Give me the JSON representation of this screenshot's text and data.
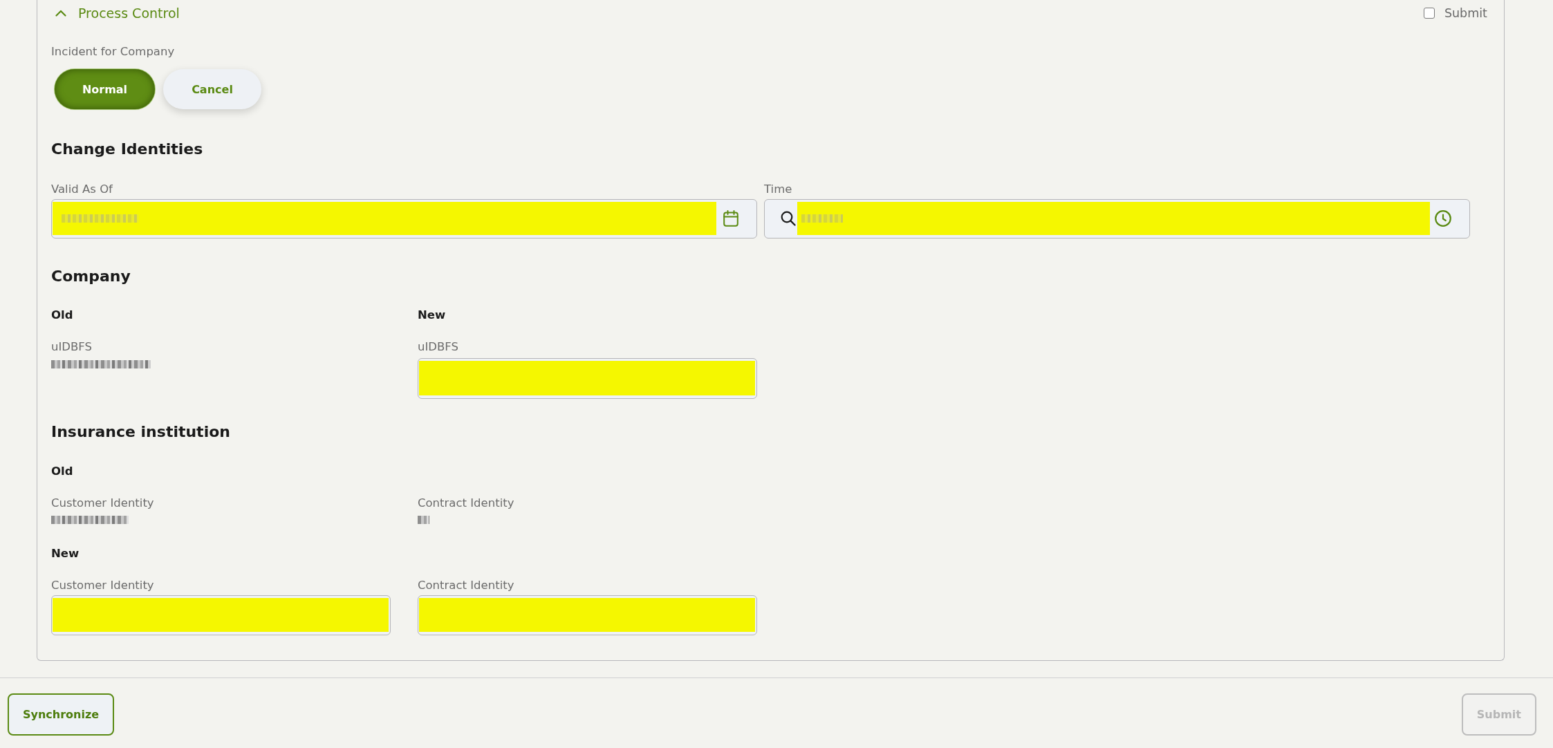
{
  "process_control": {
    "title": "Process Control",
    "expanded": true,
    "submit_checkbox": {
      "label": "Submit",
      "checked": false
    }
  },
  "incident": {
    "label": "Incident for Company",
    "options": [
      {
        "label": "Normal",
        "selected": true
      },
      {
        "label": "Cancel",
        "selected": false
      }
    ]
  },
  "change_identities": {
    "title": "Change Identities",
    "fields": [
      {
        "kind": "date",
        "label": "Valid As Of",
        "redacted": true,
        "highlighted": true
      },
      {
        "kind": "time",
        "label": "Time",
        "redacted": true,
        "highlighted": true
      }
    ]
  },
  "company": {
    "title": "Company",
    "columns": [
      {
        "title": "Old",
        "items": [
          {
            "kind": "value",
            "label": "uIDBFS",
            "redacted": true
          }
        ]
      },
      {
        "title": "New",
        "items": [
          {
            "kind": "input",
            "label": "uIDBFS",
            "highlighted": true
          }
        ]
      }
    ]
  },
  "insurance_institution": {
    "title": "Insurance institution",
    "groups": [
      {
        "title": "Old",
        "items": [
          {
            "kind": "value",
            "label": "Customer Identity",
            "redacted": true
          },
          {
            "kind": "value",
            "label": "Contract Identity",
            "redacted": true
          }
        ]
      },
      {
        "title": "New",
        "items": [
          {
            "kind": "input",
            "label": "Customer Identity",
            "highlighted": true
          },
          {
            "kind": "input",
            "label": "Contract Identity",
            "highlighted": true
          }
        ]
      }
    ]
  },
  "footer": {
    "buttons": [
      {
        "label": "Synchronize",
        "disabled": false
      },
      {
        "label": "Submit",
        "disabled": true
      }
    ]
  }
}
